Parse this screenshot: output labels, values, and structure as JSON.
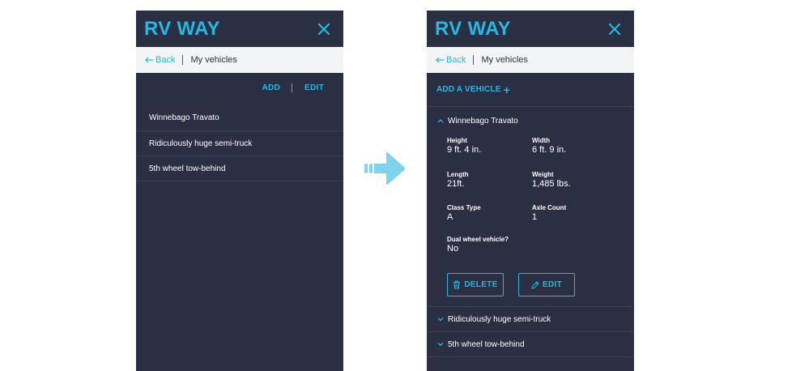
{
  "app": {
    "brand": "RV WAY"
  },
  "left": {
    "breadcrumb": {
      "back": "Back",
      "current": "My vehicles"
    },
    "actions": {
      "add": "ADD",
      "edit": "EDIT"
    },
    "vehicles": [
      {
        "name": "Winnebago Travato"
      },
      {
        "name": "Ridiculously huge semi-truck"
      },
      {
        "name": "5th wheel tow-behind"
      }
    ]
  },
  "right": {
    "breadcrumb": {
      "back": "Back",
      "current": "My vehicles"
    },
    "add_vehicle": {
      "label": "ADD A VEHICLE",
      "icon": "+"
    },
    "expanded": {
      "name": "Winnebago Travato",
      "specs": {
        "height": {
          "label": "Height",
          "value": "9 ft. 4 in."
        },
        "width": {
          "label": "Width",
          "value": "6 ft. 9 in."
        },
        "length": {
          "label": "Length",
          "value": "21ft."
        },
        "weight": {
          "label": "Weight",
          "value": "1,485 lbs."
        },
        "class_type": {
          "label": "Class Type",
          "value": "A"
        },
        "axle_count": {
          "label": "Axle Count",
          "value": "1"
        },
        "dual_wheel": {
          "label": "Dual wheel vehicle?",
          "value": "No"
        }
      },
      "delete_label": "DELETE",
      "edit_label": "EDIT"
    },
    "collapsed": [
      {
        "name": "Ridiculously huge semi-truck"
      },
      {
        "name": "5th wheel tow-behind"
      }
    ]
  },
  "colors": {
    "panel": "#2a2f44",
    "accent": "#29b6e0",
    "crumb_bg": "#f3f4f5",
    "arrow": "#7fd3ec"
  },
  "icons": {
    "close": "close-icon",
    "back": "arrow-left-icon",
    "chevron_up": "chevron-up-icon",
    "chevron_down": "chevron-down-icon",
    "trash": "trash-icon",
    "pencil": "pencil-icon",
    "flow": "right-arrow-icon"
  }
}
